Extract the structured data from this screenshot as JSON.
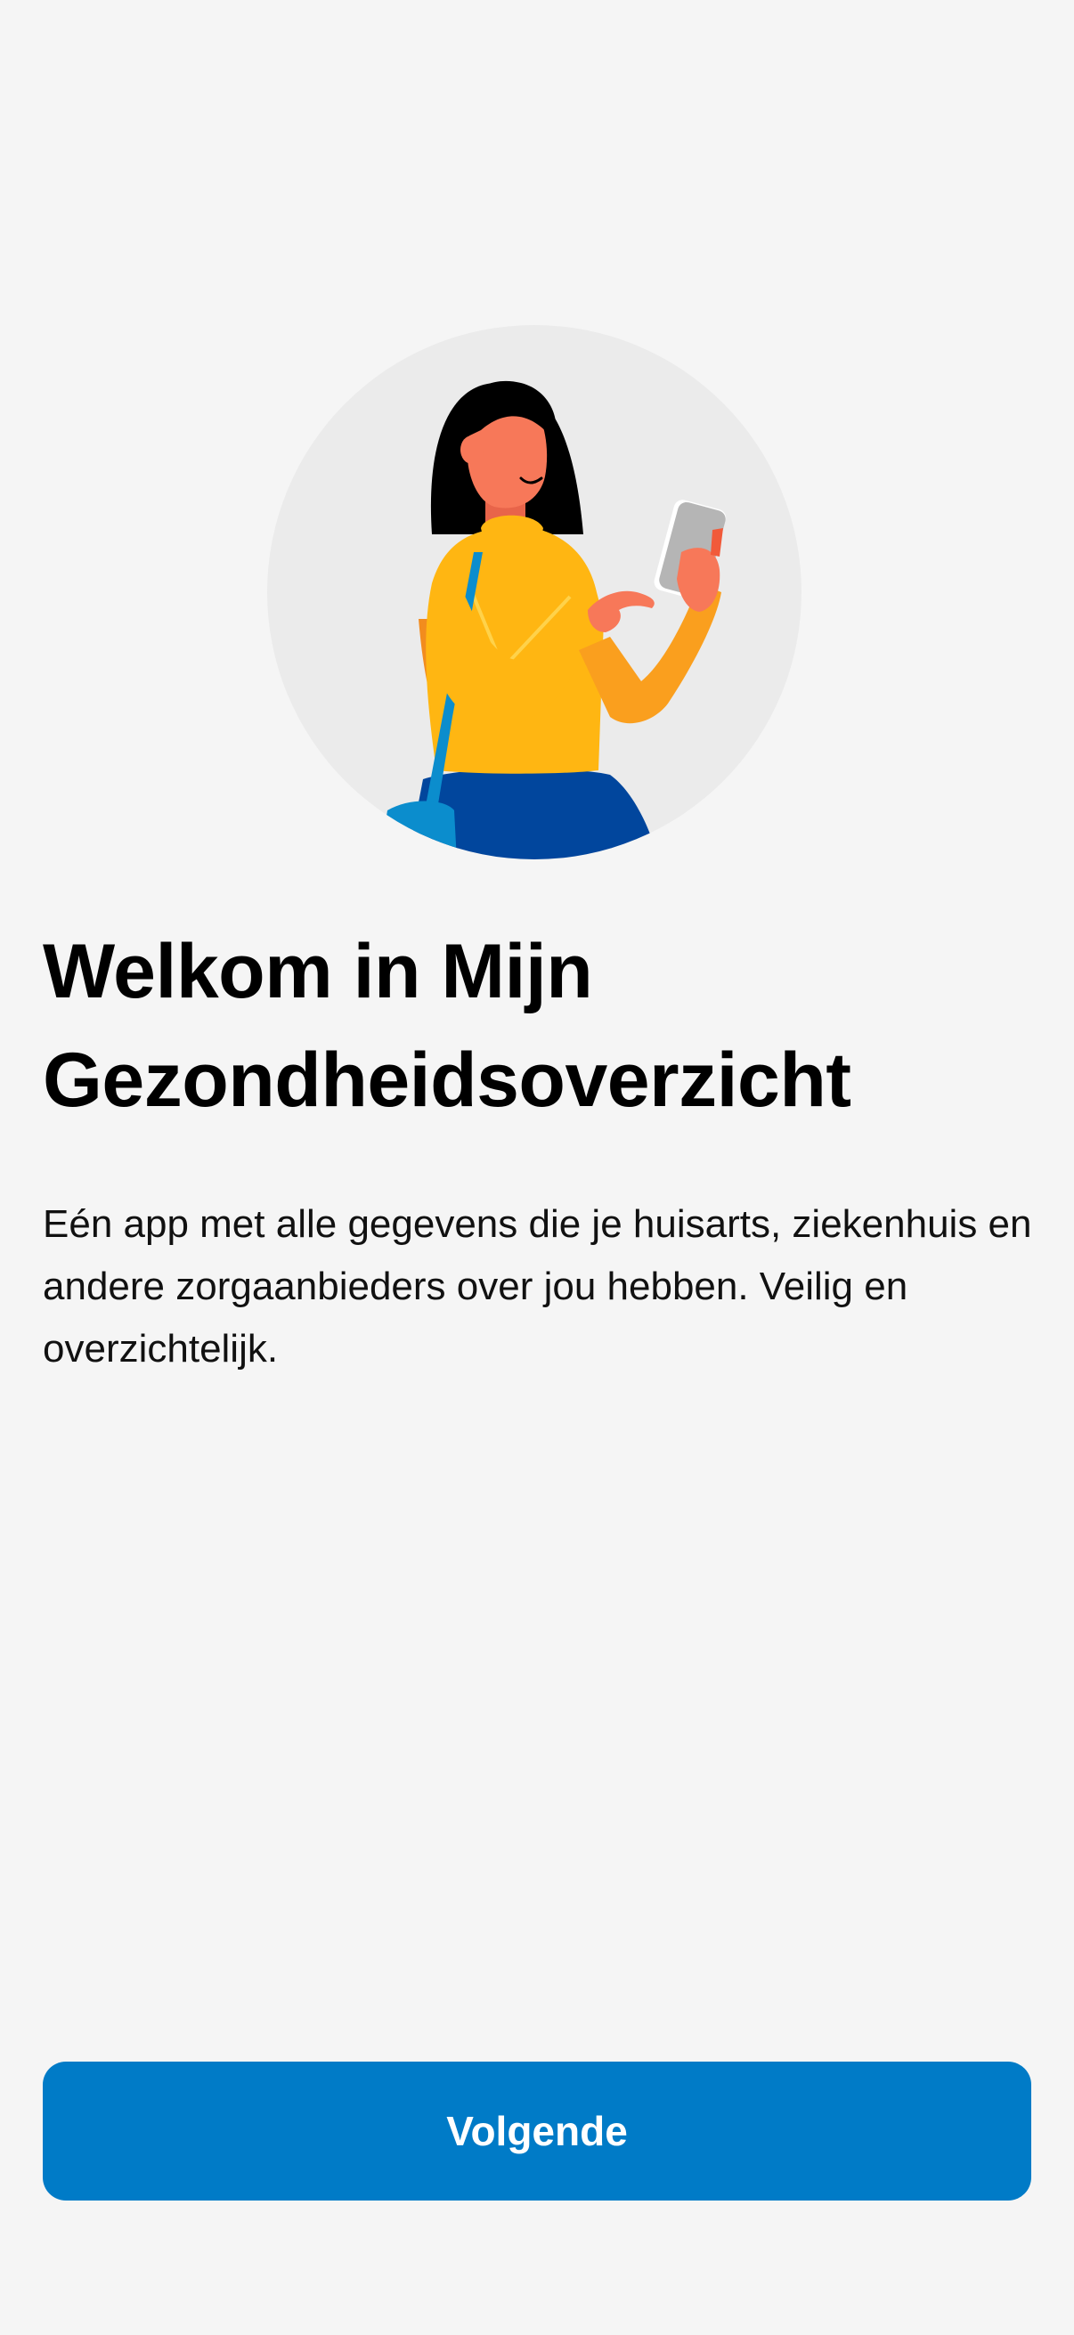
{
  "onboarding": {
    "title": "Welkom in Mijn Gezondheidsoverzicht",
    "description": "Eén app met alle gegevens die je huisarts, ziekenhuis en andere zorgaanbieders over jou hebben. Veilig en overzichtelijk.",
    "next_button_label": "Volgende"
  },
  "colors": {
    "background": "#f5f5f5",
    "primary_button": "#007bc7",
    "illustration_circle": "#ebebeb",
    "sweater": "#ffb612",
    "pants": "#01469d",
    "skin": "#f77859",
    "bag_strap": "#0b8dcd"
  },
  "illustration": {
    "icon": "woman-using-phone-illustration"
  }
}
